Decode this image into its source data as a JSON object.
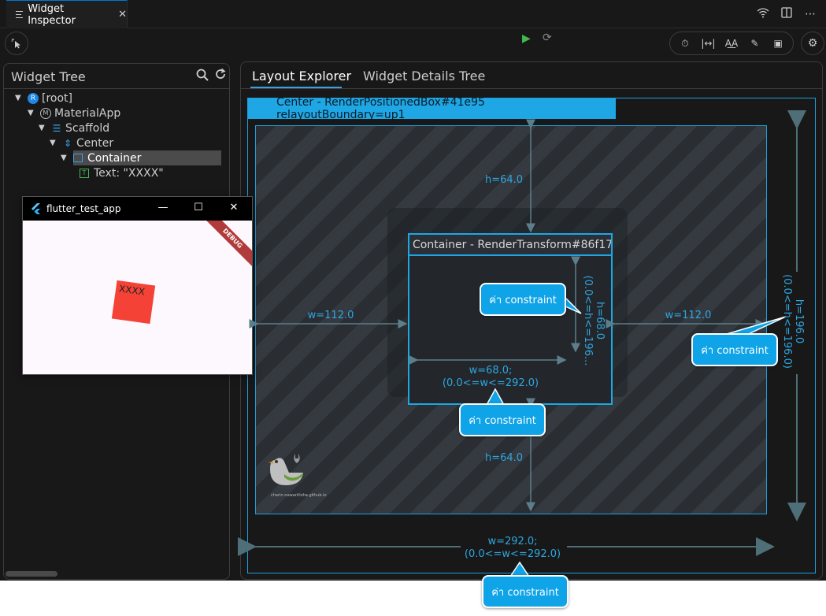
{
  "titlebar": {
    "tab_label": "Widget Inspector",
    "tab_close": "✕",
    "actions": [
      "wifi-icon",
      "split-editor-icon",
      "more-icon"
    ]
  },
  "toolbar": {
    "left_tool": "select-widget-mode-icon",
    "center_tools": [
      "play-icon",
      "hot-restart-icon"
    ],
    "right_tools": [
      "slow-animations-icon",
      "show-guidelines-icon",
      "show-baselines-icon",
      "highlight-repaints-icon",
      "highlight-oversized-images-icon"
    ],
    "settings": "settings-icon"
  },
  "widget_tree": {
    "title": "Widget Tree",
    "nodes": [
      {
        "label": "[root]",
        "badge": "R"
      },
      {
        "label": "MaterialApp",
        "badge": "M"
      },
      {
        "label": "Scaffold"
      },
      {
        "label": "Center"
      },
      {
        "label": "Container",
        "selected": true
      },
      {
        "label": "Text: \"XXXX\"",
        "badge": "T"
      }
    ]
  },
  "app_window": {
    "title": "flutter_test_app",
    "minimize": "—",
    "maximize": "☐",
    "close": "✕",
    "debug_banner": "DEBUG",
    "box_text": "XXXX",
    "box_color": "#f44336"
  },
  "layout_panel": {
    "tabs": [
      "Layout Explorer",
      "Widget Details Tree"
    ],
    "active_tab": "Layout Explorer",
    "outer_header": "Center - RenderPositionedBox#41e95 relayoutBoundary=up1",
    "inner_header": "Container - RenderTransform#86f17...",
    "top_padding": "h=64.0",
    "bottom_padding": "h=64.0",
    "left_padding": "w=112.0",
    "right_padding": "w=112.0",
    "inner_width_line1": "w=68.0;",
    "inner_width_line2": "(0.0<=w<=292.0)",
    "inner_height_line1": "h=68.0",
    "inner_height_line2": "(0.0<=h<=196...",
    "outer_height_line1": "h=196.0",
    "outer_height_line2": "(0.0<=h<=196.0)",
    "outer_width_line1": "w=292.0;",
    "outer_width_line2": "(0.0<=w<=292.0)",
    "watermark": "charin-nawaritloha.github.io"
  },
  "callouts": [
    "ค่า constraint",
    "ค่า constraint",
    "ค่า constraint",
    "ค่า constraint"
  ],
  "colors": {
    "accent": "#1ea7e4",
    "callout": "#0fa3e8",
    "play": "#3fb950"
  }
}
